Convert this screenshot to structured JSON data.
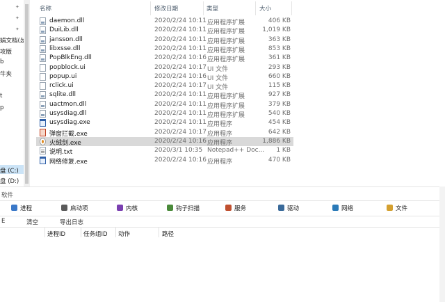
{
  "nav": {
    "items": [
      "娟文档(怂",
      "攻版",
      "b",
      "牛夹",
      "t",
      "p"
    ],
    "drives": [
      "盘 (C:)",
      "盘 (D:)"
    ]
  },
  "columns": {
    "name": "名称",
    "date": "修改日期",
    "type": "类型",
    "size": "大小"
  },
  "files": [
    {
      "name": "daemon.dll",
      "date": "2020/2/24 10:11",
      "type": "应用程序扩展",
      "size": "406 KB",
      "icon": "dll-file-icon"
    },
    {
      "name": "DuiLib.dll",
      "date": "2020/2/24 10:11",
      "type": "应用程序扩展",
      "size": "1,019 KB",
      "icon": "dll-file-icon"
    },
    {
      "name": "jansson.dll",
      "date": "2020/2/24 10:11",
      "type": "应用程序扩展",
      "size": "363 KB",
      "icon": "dll-file-icon"
    },
    {
      "name": "libxsse.dll",
      "date": "2020/2/24 10:11",
      "type": "应用程序扩展",
      "size": "853 KB",
      "icon": "dll-file-icon"
    },
    {
      "name": "PopBlkEng.dll",
      "date": "2020/2/24 10:16",
      "type": "应用程序扩展",
      "size": "361 KB",
      "icon": "dll-file-icon"
    },
    {
      "name": "popblock.ui",
      "date": "2020/2/24 10:17",
      "type": "UI 文件",
      "size": "293 KB",
      "icon": "ui-file-icon"
    },
    {
      "name": "popup.ui",
      "date": "2020/2/24 10:16",
      "type": "UI 文件",
      "size": "660 KB",
      "icon": "ui-file-icon"
    },
    {
      "name": "rclick.ui",
      "date": "2020/2/24 10:17",
      "type": "UI 文件",
      "size": "115 KB",
      "icon": "ui-file-icon"
    },
    {
      "name": "sqlite.dll",
      "date": "2020/2/24 10:11",
      "type": "应用程序扩展",
      "size": "927 KB",
      "icon": "dll-file-icon"
    },
    {
      "name": "uactmon.dll",
      "date": "2020/2/24 10:11",
      "type": "应用程序扩展",
      "size": "379 KB",
      "icon": "dll-file-icon"
    },
    {
      "name": "usysdiag.dll",
      "date": "2020/2/24 10:11",
      "type": "应用程序扩展",
      "size": "540 KB",
      "icon": "dll-file-icon"
    },
    {
      "name": "usysdiag.exe",
      "date": "2020/2/24 10:11",
      "type": "应用程序",
      "size": "454 KB",
      "icon": "exe-file-icon"
    },
    {
      "name": "弹窗拦截.exe",
      "date": "2020/2/24 10:17",
      "type": "应用程序",
      "size": "642 KB",
      "icon": "popup-blocker-icon"
    },
    {
      "name": "火绒剑.exe",
      "date": "2020/2/24 10:16",
      "type": "应用程序",
      "size": "1,886 KB",
      "icon": "huorong-sword-icon"
    },
    {
      "name": "说明.txt",
      "date": "2020/3/1 10:35",
      "type": "Notepad++ Doc...",
      "size": "1 KB",
      "icon": "text-file-icon"
    },
    {
      "name": "网络修复.exe",
      "date": "2020/2/24 10:16",
      "type": "应用程序",
      "size": "470 KB",
      "icon": "exe-file-icon"
    }
  ],
  "selected_index": 13,
  "tool": {
    "title": "软件",
    "tabs": [
      {
        "label": "进程",
        "icon": "process-icon",
        "color": "#3a78c8"
      },
      {
        "label": "启动项",
        "icon": "startup-icon",
        "color": "#5a5a5a"
      },
      {
        "label": "内核",
        "icon": "kernel-icon",
        "color": "#7a3fb0"
      },
      {
        "label": "钩子扫描",
        "icon": "hook-scan-icon",
        "color": "#4a8a3a"
      },
      {
        "label": "服务",
        "icon": "service-icon",
        "color": "#c05030"
      },
      {
        "label": "驱动",
        "icon": "driver-icon",
        "color": "#3a6a9a"
      },
      {
        "label": "网络",
        "icon": "network-icon",
        "color": "#2a7ab8"
      },
      {
        "label": "文件",
        "icon": "file-icon",
        "color": "#d4a030"
      }
    ],
    "toolbar_left": "E",
    "buttons": [
      "清空",
      "导出日志"
    ],
    "log_columns": [
      "进程ID",
      "任务组ID",
      "动作",
      "路径"
    ]
  }
}
